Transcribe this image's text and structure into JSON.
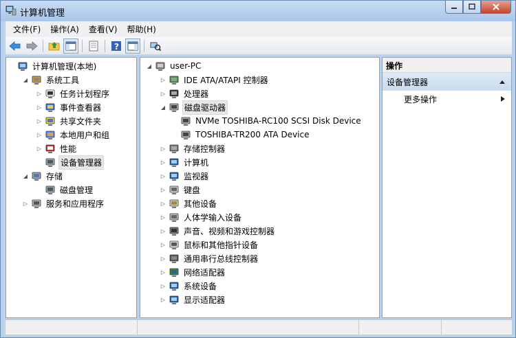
{
  "window": {
    "title": "计算机管理"
  },
  "menu": [
    "文件(F)",
    "操作(A)",
    "查看(V)",
    "帮助(H)"
  ],
  "left_tree": [
    {
      "label": "计算机管理(本地)",
      "icon": "computer-management-icon",
      "level": 0,
      "expander": ""
    },
    {
      "label": "系统工具",
      "icon": "system-tools-icon",
      "level": 1,
      "expander": "◢"
    },
    {
      "label": "任务计划程序",
      "icon": "task-scheduler-icon",
      "level": 2,
      "expander": "▷"
    },
    {
      "label": "事件查看器",
      "icon": "event-viewer-icon",
      "level": 2,
      "expander": "▷"
    },
    {
      "label": "共享文件夹",
      "icon": "shared-folders-icon",
      "level": 2,
      "expander": "▷"
    },
    {
      "label": "本地用户和组",
      "icon": "local-users-icon",
      "level": 2,
      "expander": "▷"
    },
    {
      "label": "性能",
      "icon": "performance-icon",
      "level": 2,
      "expander": "▷"
    },
    {
      "label": "设备管理器",
      "icon": "device-manager-icon",
      "level": 2,
      "expander": "",
      "selected": true
    },
    {
      "label": "存储",
      "icon": "storage-icon",
      "level": 1,
      "expander": "◢"
    },
    {
      "label": "磁盘管理",
      "icon": "disk-management-icon",
      "level": 2,
      "expander": ""
    },
    {
      "label": "服务和应用程序",
      "icon": "services-apps-icon",
      "level": 1,
      "expander": "▷"
    }
  ],
  "device_tree": {
    "root": "user-PC",
    "items": [
      {
        "label": "IDE ATA/ATAPI 控制器",
        "icon": "ide-controller-icon",
        "expander": "▷"
      },
      {
        "label": "处理器",
        "icon": "processor-icon",
        "expander": "▷"
      },
      {
        "label": "磁盘驱动器",
        "icon": "disk-drive-icon",
        "expander": "◢",
        "selected": true,
        "children": [
          "NVMe TOSHIBA-RC100 SCSI Disk Device",
          "TOSHIBA-TR200 ATA Device"
        ]
      },
      {
        "label": "存储控制器",
        "icon": "storage-controller-icon",
        "expander": "▷"
      },
      {
        "label": "计算机",
        "icon": "computer-icon",
        "expander": "▷"
      },
      {
        "label": "监视器",
        "icon": "monitor-icon",
        "expander": "▷"
      },
      {
        "label": "键盘",
        "icon": "keyboard-icon",
        "expander": "▷"
      },
      {
        "label": "其他设备",
        "icon": "other-devices-icon",
        "expander": "▷"
      },
      {
        "label": "人体学输入设备",
        "icon": "hid-icon",
        "expander": "▷"
      },
      {
        "label": "声音、视频和游戏控制器",
        "icon": "sound-icon",
        "expander": "▷"
      },
      {
        "label": "鼠标和其他指针设备",
        "icon": "mouse-icon",
        "expander": "▷"
      },
      {
        "label": "通用串行总线控制器",
        "icon": "usb-icon",
        "expander": "▷"
      },
      {
        "label": "网络适配器",
        "icon": "network-adapter-icon",
        "expander": "▷"
      },
      {
        "label": "系统设备",
        "icon": "system-devices-icon",
        "expander": "▷"
      },
      {
        "label": "显示适配器",
        "icon": "display-adapter-icon",
        "expander": "▷"
      }
    ]
  },
  "actions": {
    "header": "操作",
    "section": "设备管理器",
    "more": "更多操作"
  },
  "toolbar_icons": [
    "back-arrow-icon",
    "forward-arrow-icon",
    "up-folder-icon",
    "show-hide-tree-icon",
    "properties-icon",
    "help-icon",
    "show-hide-action-icon",
    "scan-hardware-icon"
  ],
  "colors": {
    "accent": "#4a7cc2",
    "titlebar": "#b9d1ea",
    "selection": "#e8e8e8"
  }
}
